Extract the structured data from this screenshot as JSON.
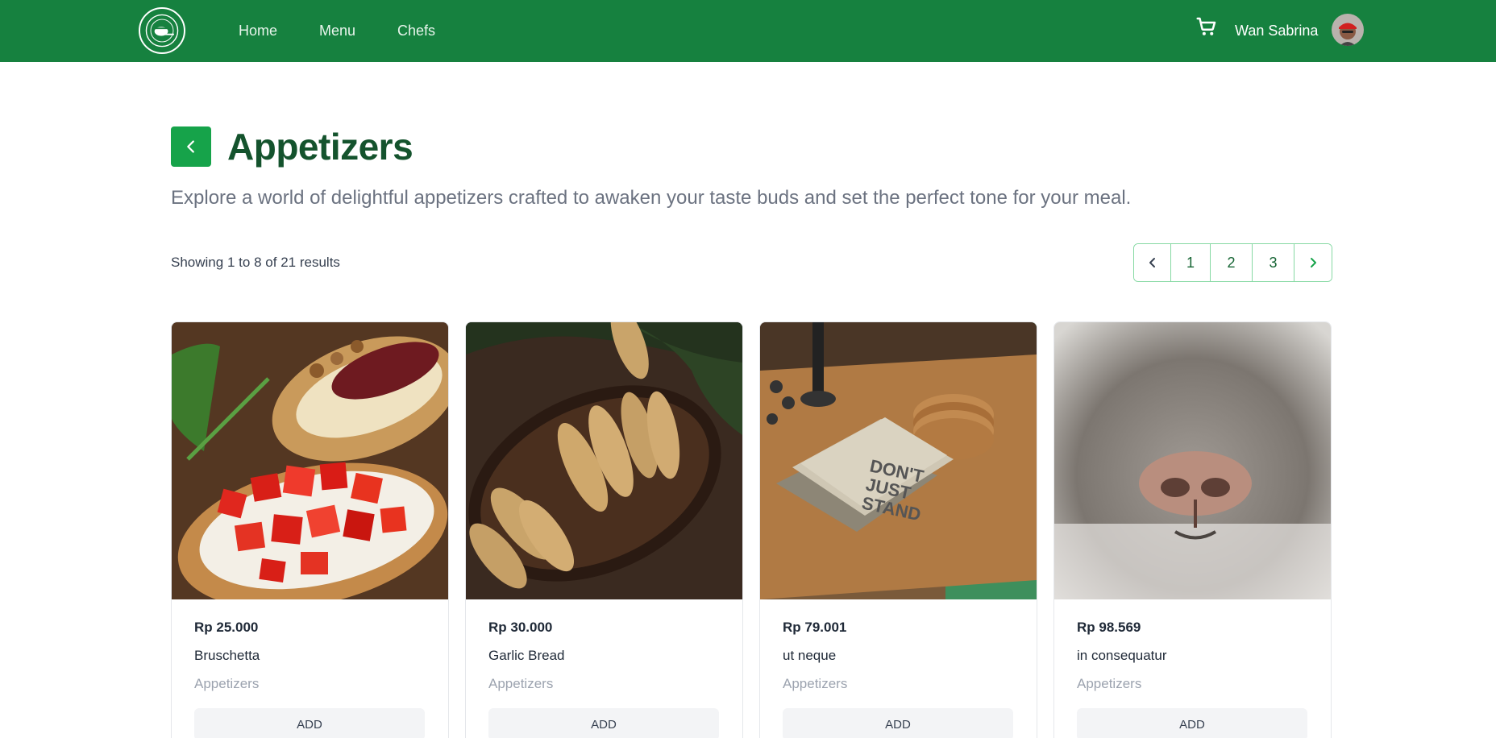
{
  "header": {
    "nav": [
      "Home",
      "Menu",
      "Chefs"
    ],
    "user_name": "Wan Sabrina",
    "brand_color": "#16813f",
    "icons": {
      "logo": "restaurant-logo",
      "cart": "cart-icon",
      "avatar": "avatar"
    }
  },
  "title_block": {
    "title": "Appetizers",
    "description": "Explore a world of delightful appetizers crafted to awaken your taste buds and set the perfect tone for your meal.",
    "back_icon": "chevron-left-icon",
    "accent": "#16a34a"
  },
  "results": {
    "prefix": "Showing",
    "from": "1",
    "to_word": "to",
    "to": "8",
    "of_word": "of",
    "total": "21",
    "suffix": "results"
  },
  "pagination": {
    "pages": [
      "1",
      "2",
      "3"
    ],
    "prev_icon": "chevron-left-icon",
    "next_icon": "chevron-right-icon"
  },
  "products": [
    {
      "price": "Rp 25.000",
      "name": "Bruschetta",
      "category": "Appetizers",
      "action": "ADD",
      "image": "bruschetta-photo"
    },
    {
      "price": "Rp 30.000",
      "name": "Garlic Bread",
      "category": "Appetizers",
      "action": "ADD",
      "image": "garlic-bread-photo"
    },
    {
      "price": "Rp 79.001",
      "name": "ut neque",
      "category": "Appetizers",
      "action": "ADD",
      "image": "coasters-photo"
    },
    {
      "price": "Rp 98.569",
      "name": "in consequatur",
      "category": "Appetizers",
      "action": "ADD",
      "image": "cat-nose-photo"
    }
  ]
}
